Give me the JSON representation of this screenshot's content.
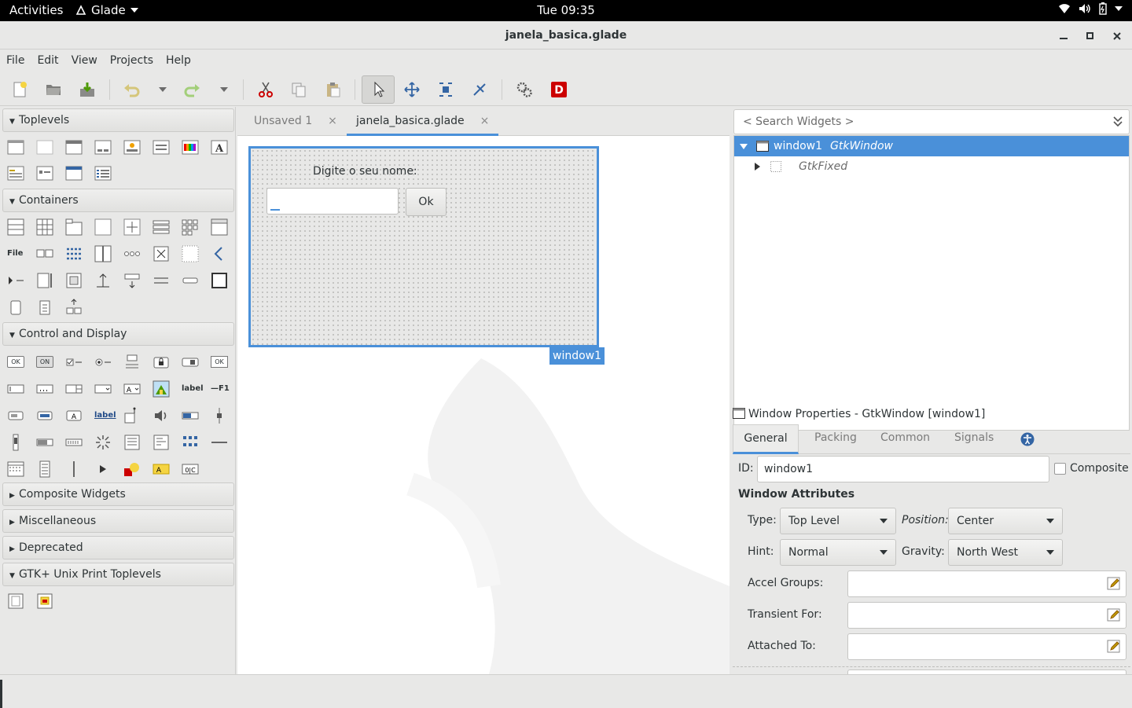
{
  "topbar": {
    "activities": "Activities",
    "app": "Glade",
    "clock": "Tue 09:35"
  },
  "window": {
    "title": "janela_basica.glade"
  },
  "menu": [
    "File",
    "Edit",
    "View",
    "Projects",
    "Help"
  ],
  "palette": {
    "toplevels": "Toplevels",
    "containers": "Containers",
    "control": "Control and Display",
    "composite": "Composite Widgets",
    "misc": "Miscellaneous",
    "deprecated": "Deprecated",
    "print": "GTK+ Unix Print Toplevels",
    "icon_file": "File",
    "icon_ok": "OK",
    "icon_on": "ON",
    "icon_label": "label",
    "icon_f1": "F1"
  },
  "tabs": [
    {
      "label": "Unsaved 1",
      "close": "×"
    },
    {
      "label": "janela_basica.glade",
      "close": "×"
    }
  ],
  "design": {
    "label": "Digite o seu nome:",
    "entry_value": "",
    "button": "Ok",
    "window_label": "window1"
  },
  "inspector": {
    "search_placeholder": "< Search Widgets >",
    "rows": [
      {
        "name": "window1",
        "type": "GtkWindow"
      },
      {
        "name": "",
        "type": "GtkFixed"
      }
    ]
  },
  "properties": {
    "header": "Window Properties - GtkWindow [window1]",
    "tabs": [
      "General",
      "Packing",
      "Common",
      "Signals"
    ],
    "id_label": "ID:",
    "id_value": "window1",
    "composite": "Composite",
    "section": "Window Attributes",
    "type_label": "Type:",
    "type_value": "Top Level",
    "position_label": "Position:",
    "position_value": "Center",
    "hint_label": "Hint:",
    "hint_value": "Normal",
    "gravity_label": "Gravity:",
    "gravity_value": "North West",
    "accel_label": "Accel Groups:",
    "transient_label": "Transient For:",
    "attached_label": "Attached To:"
  },
  "colors": {
    "selection": "#4a90d9",
    "topbar": "#000000"
  }
}
